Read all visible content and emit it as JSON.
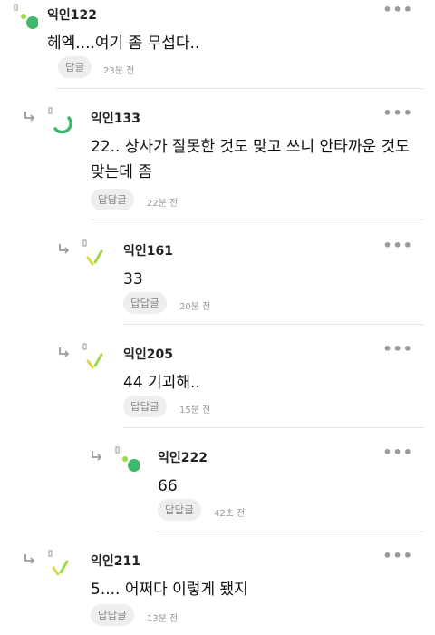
{
  "comments": [
    {
      "author": "익인122",
      "body": "헤엑....여기 좀 무섭다..",
      "reply": "답글",
      "time": "23분 전",
      "avatar": "green-dot-avatar"
    },
    {
      "author": "익인133",
      "body": "22.. 상사가 잘못한 것도 맞고 쓰니 안타까운 것도 맞는데 좀",
      "reply": "답답글",
      "time": "22분 전",
      "avatar": "green-arc-avatar"
    },
    {
      "author": "익인161",
      "body": "33",
      "reply": "답답글",
      "time": "20분 전",
      "avatar": "yellow-green-slash-avatar"
    },
    {
      "author": "익인205",
      "body": "44 기괴해..",
      "reply": "답답글",
      "time": "15분 전",
      "avatar": "yellow-green-slash-avatar"
    },
    {
      "author": "익인222",
      "body": "66",
      "reply": "답답글",
      "time": "42초 전",
      "avatar": "green-dot-avatar"
    },
    {
      "author": "익인211",
      "body": "5.... 어쩌다 이렇게 됐지",
      "reply": "답답글",
      "time": "13분 전",
      "avatar": "yellow-green-slash-avatar"
    }
  ],
  "more_label": "•••",
  "colors": {
    "accent_green": "#3cb96a",
    "light_green": "#9ed84a",
    "yellow": "#d8d94a",
    "muted": "#9a9a9a",
    "chip_bg": "#eeeeee"
  }
}
